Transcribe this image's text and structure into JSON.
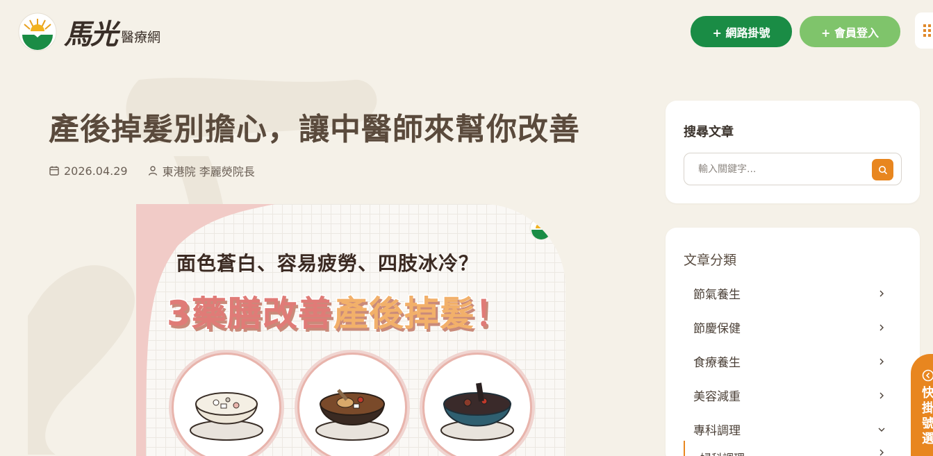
{
  "header": {
    "logo_brush": "馬光",
    "logo_sub": "醫療網",
    "register_button": "+ 網路掛號",
    "login_button": "+ 會員登入",
    "brand_green": "#1a8c45",
    "login_green": "#7fc46b",
    "accent_orange": "#e8861f",
    "menu_icon": "grid-menu-icon"
  },
  "article": {
    "title": "產後掉髮別擔心，讓中醫師來幫你改善",
    "date": "2026.04.29",
    "author": "東港院 李麗熒院長",
    "date_icon": "calendar-icon",
    "author_icon": "user-icon"
  },
  "hero": {
    "subtitle": "面色蒼白、容易疲勞、四肢冰冷？",
    "headline_part1": "3藥膳改善",
    "headline_part2": "產後掉髮",
    "headline_part3": "！"
  },
  "sidebar": {
    "search": {
      "title": "搜尋文章",
      "placeholder": "輸入關鍵字...",
      "button_icon": "search-icon"
    },
    "categories": {
      "title": "文章分類",
      "items": [
        {
          "label": "節氣養生"
        },
        {
          "label": "節慶保健"
        },
        {
          "label": "食療養生"
        },
        {
          "label": "美容減重"
        },
        {
          "label": "專科調理"
        }
      ],
      "sub_item": "婦科調理"
    }
  },
  "floating_tab": {
    "label": "快掛號選"
  }
}
